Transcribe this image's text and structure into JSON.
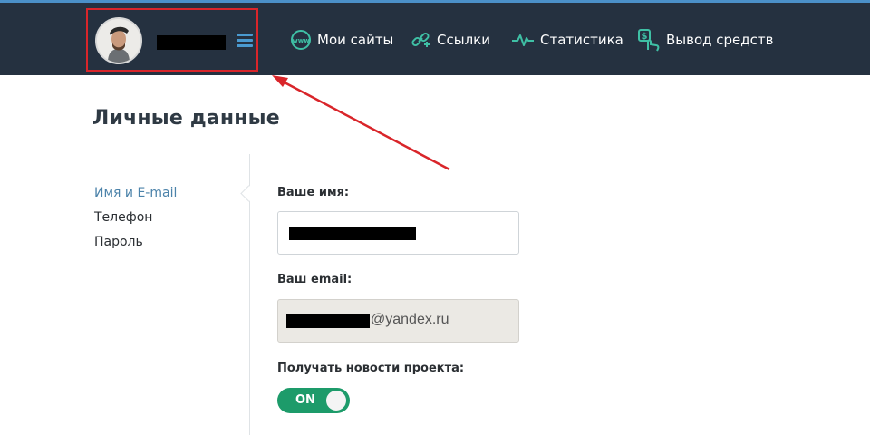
{
  "header": {
    "user": {
      "avatar_icon": "user-avatar-photo",
      "name_redacted": true,
      "menu_icon": "hamburger-icon",
      "highlight_color": "#d9252a"
    },
    "nav": [
      {
        "label": "Мои сайты",
        "icon": "www-icon"
      },
      {
        "label": "Ссылки",
        "icon": "link-plus-icon"
      },
      {
        "label": "Статистика",
        "icon": "pulse-icon"
      },
      {
        "label": "Вывод средств",
        "icon": "money-hand-icon"
      }
    ],
    "bg_color": "#253140",
    "accent_color": "#4b90c9"
  },
  "page": {
    "title": "Личные данные"
  },
  "sidebar": {
    "items": [
      {
        "label": "Имя и E-mail",
        "active": true
      },
      {
        "label": "Телефон",
        "active": false
      },
      {
        "label": "Пароль",
        "active": false
      }
    ]
  },
  "form": {
    "name_label": "Ваше имя:",
    "name_value_redacted": true,
    "email_label": "Ваш email:",
    "email_domain": "@yandex.ru",
    "email_local_redacted": true,
    "news_label": "Получать новости проекта:",
    "news_toggle": {
      "label": "ON",
      "state": "on",
      "color": "#1d9b6a"
    }
  },
  "annotation": {
    "type": "arrow",
    "color": "#d9252a",
    "points_to": "user-block"
  }
}
